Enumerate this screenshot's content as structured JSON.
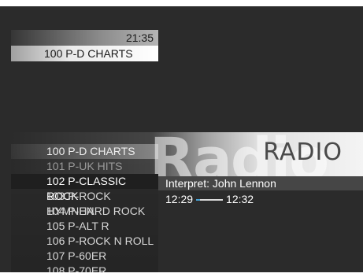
{
  "top_osd": {
    "clock": "21:35",
    "current_channel": "100 P-D CHARTS"
  },
  "banner": {
    "watermark": "Radio",
    "title": "RADIO"
  },
  "channel_list": [
    {
      "label": "100 P-D CHARTS",
      "state": "first"
    },
    {
      "label": "101 P-UK HITS",
      "state": "dim"
    },
    {
      "label": "102 P-CLASSIC ROCK",
      "state": "selected"
    },
    {
      "label": "103 P-ROCK HYMNEN",
      "state": "normal"
    },
    {
      "label": "104 P-HARD ROCK",
      "state": "normal"
    },
    {
      "label": "105 P-ALT R",
      "state": "normal"
    },
    {
      "label": "106 P-ROCK N ROLL",
      "state": "normal"
    },
    {
      "label": "107 P-60ER",
      "state": "normal"
    },
    {
      "label": "108 P-70ER",
      "state": "normal"
    }
  ],
  "info": {
    "artist": "Interpret: John Lennon",
    "start_time": "12:29",
    "end_time": "12:32",
    "progress": 0.15,
    "progress_color": "#4aa3d6"
  }
}
